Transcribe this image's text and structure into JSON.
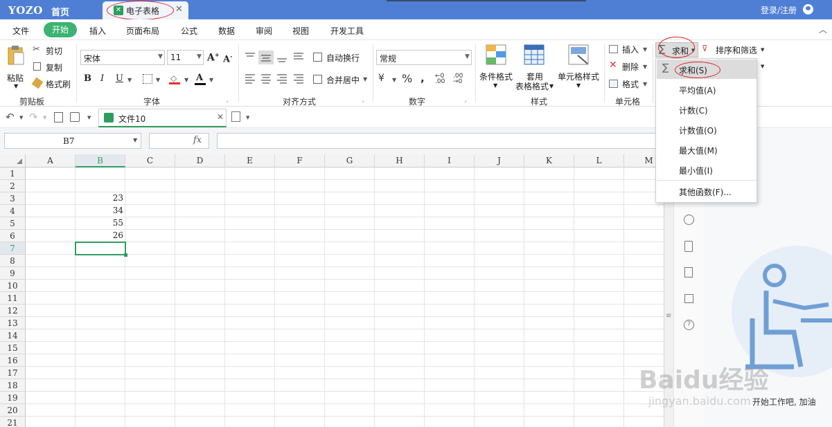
{
  "titlebar": {
    "logo": "YOZO",
    "home": "首页",
    "doc_tab": "电子表格",
    "login": "登录/注册"
  },
  "menu": {
    "items": [
      "文件",
      "开始",
      "插入",
      "页面布局",
      "公式",
      "数据",
      "审阅",
      "视图",
      "开发工具"
    ],
    "active": "开始"
  },
  "ribbon": {
    "clipboard": {
      "paste": "粘贴",
      "cut": "剪切",
      "copy": "复制",
      "format_painter": "格式刷",
      "label": "剪贴板"
    },
    "font": {
      "name": "宋体",
      "size": "11",
      "bold": "B",
      "italic": "I",
      "underline": "U",
      "label": "字体"
    },
    "align": {
      "wrap": "自动换行",
      "merge": "合并居中",
      "label": "对齐方式"
    },
    "number": {
      "format": "常规",
      "label": "数字"
    },
    "styles": {
      "conditional": "条件格式",
      "table_style_1": "套用",
      "table_style_2": "表格格式",
      "cell_style": "单元格样式",
      "label": "样式"
    },
    "cells": {
      "insert": "插入",
      "delete": "删除",
      "format": "格式",
      "label": "单元格"
    },
    "edit": {
      "sum": "求和",
      "sort_filter": "排序和筛选"
    }
  },
  "quickbar": {
    "file_tab": "文件10"
  },
  "formula": {
    "cell_ref": "B7",
    "fx": "fx"
  },
  "grid": {
    "columns": [
      "A",
      "B",
      "C",
      "D",
      "E",
      "F",
      "G",
      "H",
      "I",
      "J",
      "K",
      "L",
      "M"
    ],
    "rows": [
      "1",
      "2",
      "3",
      "4",
      "5",
      "6",
      "7",
      "8",
      "9",
      "10",
      "11",
      "12",
      "13",
      "14",
      "15",
      "16",
      "17",
      "18",
      "19",
      "20",
      "21"
    ],
    "values": {
      "B3": "23",
      "B4": "34",
      "B5": "55",
      "B6": "26"
    },
    "selected": "B7"
  },
  "dropdown": {
    "items": [
      "求和(S)",
      "平均值(A)",
      "计数(C)",
      "计数值(O)",
      "最大值(M)",
      "最小值(I)",
      "其他函数(F)..."
    ]
  },
  "side_panel": {
    "text": "开始工作吧, 加油"
  },
  "watermark": {
    "brand": "Baidu经验",
    "url": "jingyan.baidu.com"
  },
  "colors": {
    "title_bg": "#4f7fd5",
    "active_green": "#3cb371",
    "selection_green": "#2e9e5e",
    "annotation_red": "#dd2222"
  }
}
